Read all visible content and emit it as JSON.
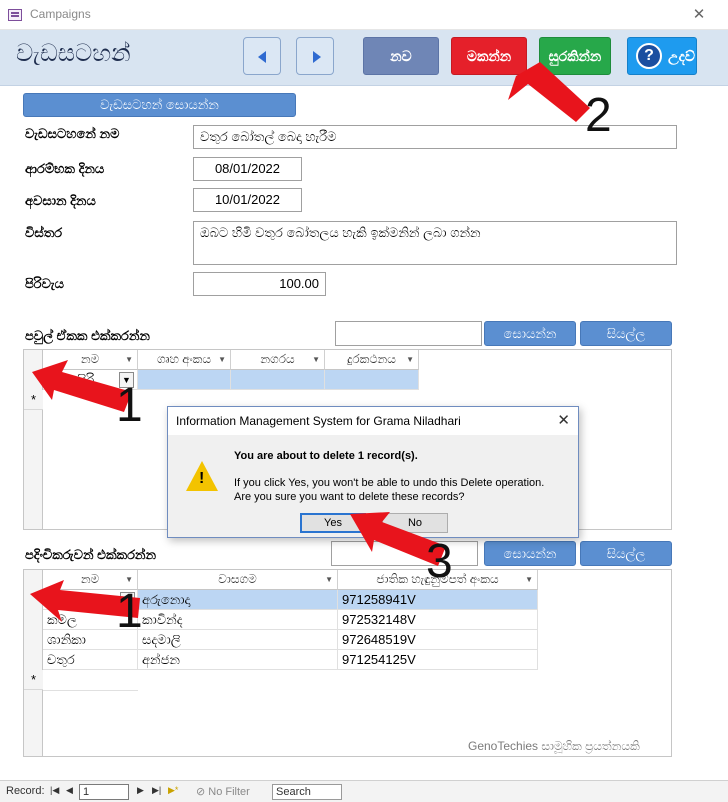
{
  "window": {
    "title": "Campaigns",
    "close": "✕"
  },
  "header": {
    "form_title": "වැඩසටහන්",
    "new_label": "නව",
    "delete_label": "මකන්න",
    "save_label": "සුරකින්න",
    "help_label": "උදව්",
    "help_glyph": "?"
  },
  "campaign": {
    "search_button": "වැඩසටහන් සොයන්න",
    "fields": [
      {
        "label": "වැඩසටහනේ නම",
        "value": "වතුර බෝතල් බෙදා හැරීම"
      },
      {
        "label": "ආරම්භක දිනය",
        "value": "08/01/2022"
      },
      {
        "label": "අවසාන දිනය",
        "value": "10/01/2022"
      },
      {
        "label": "විස්තර",
        "value": "ඔබට හිමි වතුර බෝතලය හැකි ඉක්මනින් ලබා ගන්න"
      },
      {
        "label": "පිරිවැය",
        "value": "100.00"
      }
    ]
  },
  "families": {
    "title": "පවුල් ඒකක එක්කරන්න",
    "search_value": "",
    "search_button": "සොයන්න",
    "all_button": "සියල්ල",
    "columns": [
      "නම",
      "ගෘහ අංකය",
      "නගරය",
      "දුරකථනය"
    ],
    "rows": [
      [
        "සිරි",
        "",
        "",
        ""
      ]
    ],
    "new_row_marker": "*"
  },
  "beneficiaries": {
    "title": "පදිංචිකරුවන් එක්කරන්න",
    "search_value": "",
    "search_button": "සොයන්න",
    "all_button": "සියල්ල",
    "columns": [
      "නම",
      "වාසගම",
      "ජාතික හැඳුනුම්පත් අංකය"
    ],
    "rows": [
      [
        "",
        "අරුනොදා",
        "971258941V"
      ],
      [
        "කමල",
        "කාවින්ද",
        "972532148V"
      ],
      [
        "ශානිකා",
        "සදමාලි",
        "972648519V"
      ],
      [
        "චතුර",
        "අන්ජන",
        "971254125V"
      ]
    ],
    "new_row_marker": "*"
  },
  "dialog": {
    "title": "Information Management System for Grama Niladhari",
    "message": "You are about to delete 1 record(s).",
    "detail_line1": "If you click Yes, you won't be able to undo this Delete operation.",
    "detail_line2": "Are you sure you want to delete these records?",
    "yes": "Yes",
    "no": "No",
    "warning_glyph": "!"
  },
  "annotations": [
    "1",
    "1",
    "2",
    "3"
  ],
  "footer": {
    "credit": "GenoTechies සාමූහික ප්‍රයත්නයකි",
    "record_label": "Record:",
    "record_number": "1",
    "first": "|◀",
    "prev": "◀",
    "next": "▶",
    "last": "▶|",
    "new_rec": "▶*",
    "filter": "No Filter",
    "search": "Search"
  },
  "colors": {
    "delete": "#e5202a",
    "save": "#27a84a",
    "help": "#1e9bef",
    "new": "#6f86b6",
    "arrow": "#e8141c",
    "header_bg": "#d8e4f1"
  }
}
